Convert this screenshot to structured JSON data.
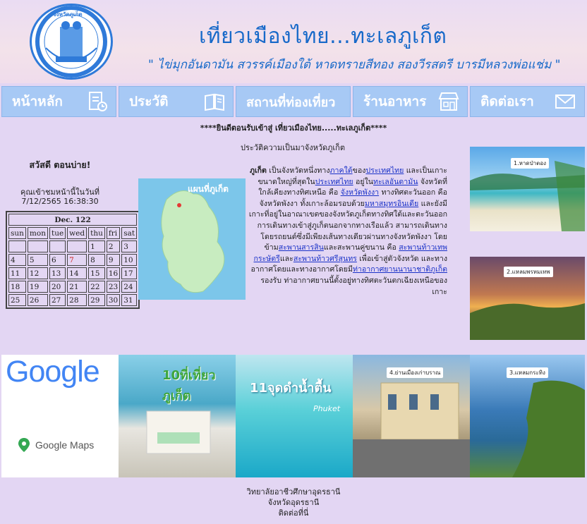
{
  "header": {
    "title": "เที่ยวเมืองไทย...ทะเลภูเก็ต",
    "slogan": "\" ไข่มุกอันดามัน สวรรค์เมืองใต้ หาดทรายสีทอง สองวีรสตรี บารมีหลวงพ่อแช่ม \"",
    "seal_text": "จังหวัดภูเก็ต"
  },
  "nav": [
    {
      "label": "หน้าหลัก",
      "icon": "document-clock-icon"
    },
    {
      "label": "ประวัติ",
      "icon": "book-icon"
    },
    {
      "label": "สถานที่ท่องเที่ยว",
      "icon": "landmark-icon"
    },
    {
      "label": "ร้านอาหาร",
      "icon": "store-icon"
    },
    {
      "label": "ติดต่อเรา",
      "icon": "mail-icon"
    }
  ],
  "welcome": "****ยินดีตอนรับเข้าสู่ เที่ยวเมืองไทย.....ทะเลภูเก็ต****",
  "sidebar": {
    "greeting": "สวัสดี ตอนบ่าย!",
    "visit_text": "คุณเข้าชมหน้านี้ในวันที่ 7/12/2565 16:38:30"
  },
  "calendar": {
    "caption": "Dec. 122",
    "days": [
      "sun",
      "mon",
      "tue",
      "wed",
      "thu",
      "fri",
      "sat"
    ],
    "rows": [
      [
        "",
        "",
        "",
        "",
        "1",
        "2",
        "3"
      ],
      [
        "4",
        "5",
        "6",
        "7",
        "8",
        "9",
        "10"
      ],
      [
        "11",
        "12",
        "13",
        "14",
        "15",
        "16",
        "17"
      ],
      [
        "18",
        "19",
        "20",
        "21",
        "22",
        "23",
        "24"
      ],
      [
        "25",
        "26",
        "27",
        "28",
        "29",
        "30",
        "31"
      ]
    ],
    "today": "7"
  },
  "article": {
    "heading": "ประวัติความเป็นมาจังหวัดภูเก็ต",
    "map_title": "แผนที่ภูเก็ต",
    "lead": "ภูเก็ต",
    "t1": " เป็นจังหวัดหนึ่งทาง",
    "l1": "ภาคใต้",
    "t2": "ของ",
    "l2": "ประเทศไทย",
    "t3": " และเป็นเกาะขนาดใหญ่ที่สุดใน",
    "l3": "ประเทศไทย",
    "t4": " อยู่ใน",
    "l4": "ทะเลอันดามัน",
    "t5": " จังหวัดที่ใกล้เคียงทางทิศเหนือ คือ ",
    "l5": "จังหวัดพังงา",
    "t6": " ทางทิศตะวันออก คือ จังหวัดพังงา ทั้งเกาะล้อมรอบด้วย",
    "l6": "มหาสมุทรอินเดีย",
    "t7": " และยังมีเกาะที่อยู่ในอาณาเขตของจังหวัดภูเก็ตทางทิศใต้และตะวันออก การเดินทางเข้าสู่ภูเก็ตนอกจากทางเรือแล้ว สามารถเดินทางโดยรถยนต์ซึ่งมีเพียงเส้นทางเดียวผ่านทางจังหวัดพังงา โดยข้าม",
    "l7": "สะพานสารสิน",
    "t8": "และสะพานคู่ขนาน คือ ",
    "l8": "สะพานท้าวเทพกระษัตรี",
    "t9": "และ",
    "l9": "สะพานท้าวศรีสุนทร",
    "t10": " เพื่อเข้าสู่ตัวจังหวัด และทางอากาศโดยและทางอากาศโดยมี",
    "l10": "ท่าอากาศยานนานาชาติภูเก็ต",
    "t11": "รองรับ ท่าอากาศยานนี้ตั้งอยู่ทางทิศตะวันตกเฉียงเหนือของเกาะ"
  },
  "photos": {
    "right1": "1.หาดป่าตอง",
    "right2": "2.แหลมพรหมเทพ",
    "b1_google": "Google",
    "b1_maps": "Google Maps",
    "b2_title": "10ที่เที่ยวภูเก็ต",
    "b3_title": "11จุดดำน้ำตื้น",
    "b3_sub": "Phuket",
    "b4_label": "4.ย่านเมืองเก่าบราณ",
    "b5_label": "3.แหลมกระทิง"
  },
  "footer": {
    "line1": "วิทยาลัยอาชีวศึกษาอุดรธานี",
    "line2": "จังหวัดอุดรธานี",
    "line3": "ติดต่อที่นี่"
  }
}
